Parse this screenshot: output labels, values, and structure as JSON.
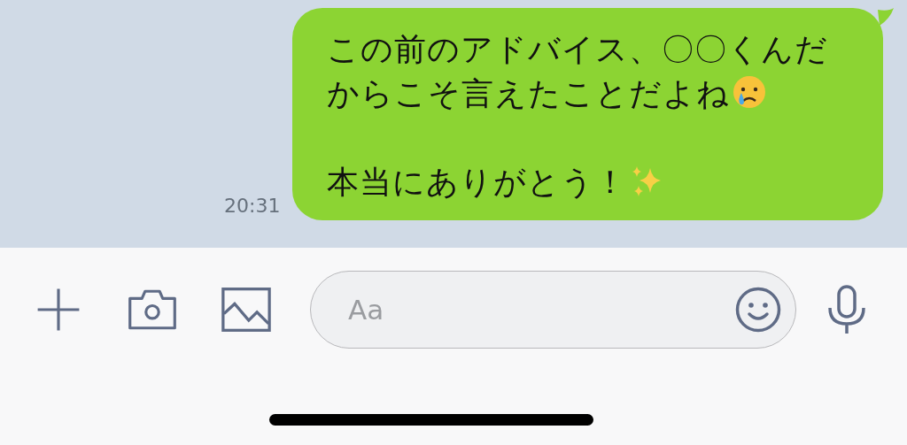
{
  "message": {
    "time": "20:31",
    "paragraphs": [
      {
        "text": "この前のアドバイス、〇〇くんだからこそ言えたことだよね",
        "kind": "crying-face"
      },
      {
        "text": "本当にありがとう！",
        "kind": "sparkles"
      }
    ]
  },
  "composer": {
    "placeholder": "Aa"
  }
}
